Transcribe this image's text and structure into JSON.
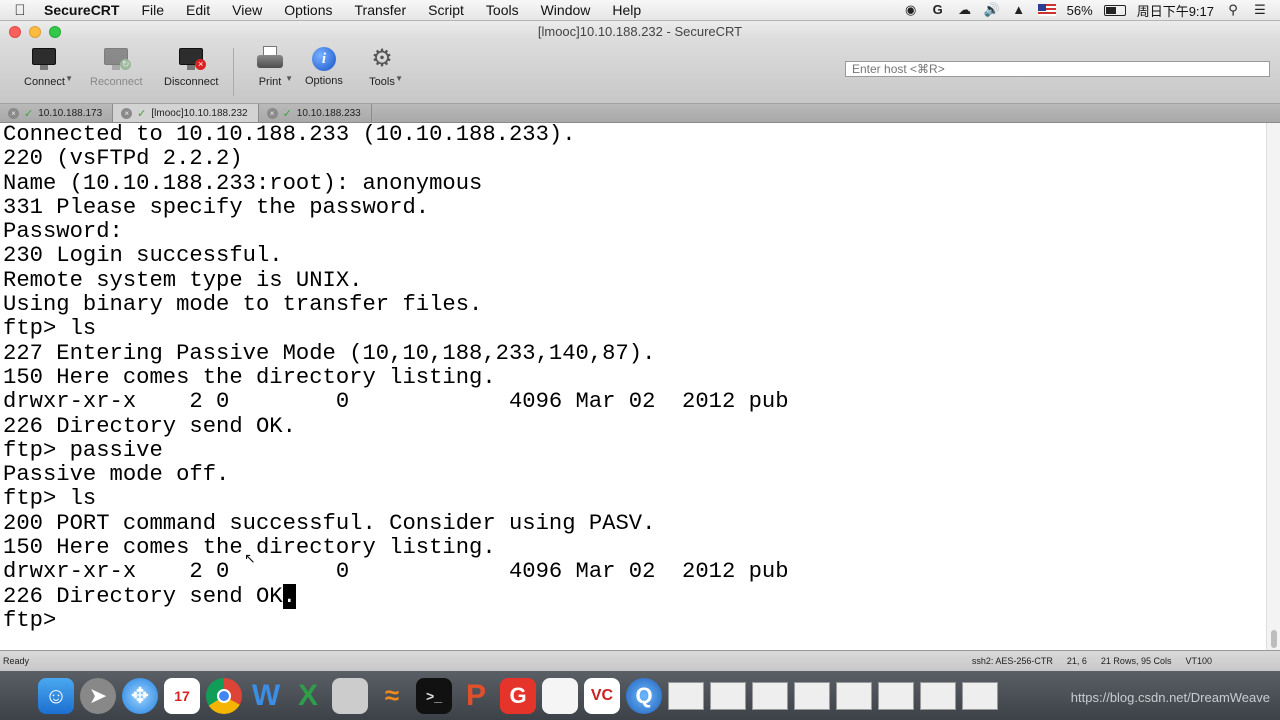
{
  "menubar": {
    "apple": "",
    "app_name": "SecureCRT",
    "items": [
      "File",
      "Edit",
      "View",
      "Options",
      "Transfer",
      "Script",
      "Tools",
      "Window",
      "Help"
    ],
    "battery_percent": "56%",
    "battery_level": 0.56,
    "clock": "周日下午9:17"
  },
  "window": {
    "title": "[lmooc]10.10.188.232 - SecureCRT"
  },
  "toolbar": {
    "connect": "Connect",
    "reconnect": "Reconnect",
    "disconnect": "Disconnect",
    "print": "Print",
    "options": "Options",
    "tools": "Tools",
    "host_placeholder": "Enter host <⌘R>"
  },
  "tabs": [
    {
      "label": "10.10.188.173"
    },
    {
      "label": "[lmooc]10.10.188.232"
    },
    {
      "label": "10.10.188.233"
    }
  ],
  "terminal": {
    "lines": [
      "Connected to 10.10.188.233 (10.10.188.233).",
      "220 (vsFTPd 2.2.2)",
      "Name (10.10.188.233:root): anonymous",
      "331 Please specify the password.",
      "Password:",
      "230 Login successful.",
      "Remote system type is UNIX.",
      "Using binary mode to transfer files.",
      "ftp> ls",
      "227 Entering Passive Mode (10,10,188,233,140,87).",
      "150 Here comes the directory listing.",
      "drwxr-xr-x    2 0        0            4096 Mar 02  2012 pub",
      "226 Directory send OK.",
      "ftp> passive",
      "Passive mode off.",
      "ftp> ls",
      "200 PORT command successful. Consider using PASV.",
      "150 Here comes the directory listing.",
      "drwxr-xr-x    2 0        0            4096 Mar 02  2012 pub"
    ],
    "cursor_line_text": "226 Directory send OK",
    "cursor_char": ".",
    "prompt_line": "ftp>"
  },
  "statusbar": {
    "ready": "Ready",
    "cipher": "ssh2: AES-256-CTR",
    "position": "21, 6",
    "size": "21 Rows, 95 Cols",
    "emulation": "VT100"
  },
  "watermark": "https://blog.csdn.net/DreamWeave",
  "colors": {
    "terminal_bg": "#ffffff",
    "terminal_fg": "#000000",
    "tab_check": "#3aa53a"
  }
}
